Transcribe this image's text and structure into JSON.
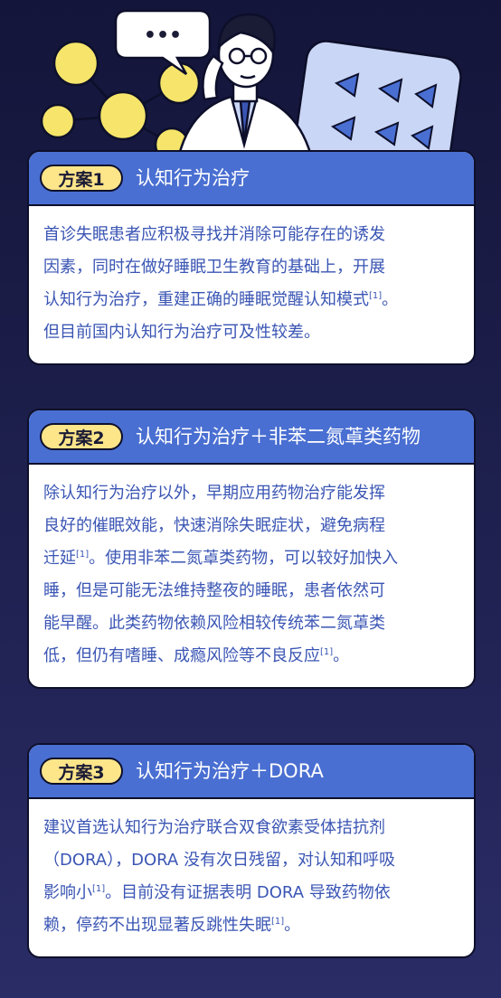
{
  "colors": {
    "background": "#1a1b45",
    "card_header": "#4a6fd2",
    "pill": "#fde58a",
    "body_text": "#3a55b4",
    "molecule": "#f6e56a",
    "pill_pack": "#c9d6f5"
  },
  "illustration": {
    "speech_bubble_text": "•••",
    "icons": [
      "molecule-icon",
      "doctor-icon",
      "speech-bubble-icon",
      "pill-pack-icon"
    ]
  },
  "plans": [
    {
      "badge": "方案1",
      "title": "认知行为治疗",
      "lines": [
        {
          "text": "首诊失眠患者应积极寻找并消除可能存在的诱发",
          "ref": ""
        },
        {
          "text": "因素，同时在做好睡眠卫生教育的基础上，开展",
          "ref": ""
        },
        {
          "text": "认知行为治疗，重建正确的睡眠觉醒认知模式",
          "ref": "[1]",
          "after": "。"
        },
        {
          "text": "但目前国内认知行为治疗可及性较差。",
          "ref": ""
        }
      ]
    },
    {
      "badge": "方案2",
      "title": "认知行为治疗＋非苯二氮䓬类药物",
      "lines": [
        {
          "text": "除认知行为治疗以外，早期应用药物治疗能发挥",
          "ref": ""
        },
        {
          "text": "良好的催眠效能，快速消除失眠症状，避免病程",
          "ref": ""
        },
        {
          "text": "迁延",
          "ref": "[1]",
          "after": "。使用非苯二氮䓬类药物，可以较好加快入"
        },
        {
          "text": "睡，但是可能无法维持整夜的睡眠，患者依然可",
          "ref": ""
        },
        {
          "text": "能早醒。此类药物依赖风险相较传统苯二氮䓬类",
          "ref": ""
        },
        {
          "text": "低，但仍有嗜睡、成瘾风险等不良反应",
          "ref": "[1]",
          "after": "。"
        }
      ]
    },
    {
      "badge": "方案3",
      "title": "认知行为治疗＋DORA",
      "lines": [
        {
          "text": "建议首选认知行为治疗联合双食欲素受体拮抗剂",
          "ref": ""
        },
        {
          "text": "（DORA），DORA 没有次日残留，对认知和呼吸",
          "ref": ""
        },
        {
          "text": "影响小",
          "ref": "[1]",
          "after": "。目前没有证据表明 DORA 导致药物依"
        },
        {
          "text": "赖，停药不出现显著反跳性失眠",
          "ref": "[1]",
          "after": "。"
        }
      ]
    }
  ]
}
